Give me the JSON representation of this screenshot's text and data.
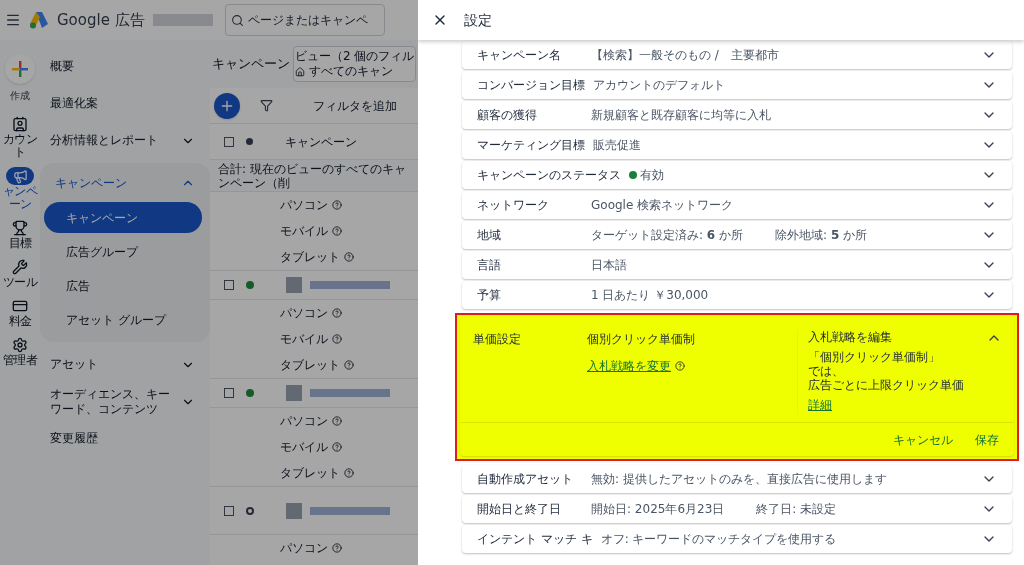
{
  "topbar": {
    "product": "Google 広告",
    "search": {
      "placeholder": "ページまたはキャンペ"
    }
  },
  "rail": [
    {
      "label": "作成",
      "kind": "create",
      "selected": false
    },
    {
      "label": "カウント",
      "kind": "account",
      "selected": false
    },
    {
      "label": "ャンペーン",
      "kind": "campaign",
      "selected": true
    },
    {
      "label": "目標",
      "kind": "goal",
      "selected": false
    },
    {
      "label": "ツール",
      "kind": "tools",
      "selected": false
    },
    {
      "label": "料金",
      "kind": "billing",
      "selected": false
    },
    {
      "label": "管理者",
      "kind": "admin",
      "selected": false
    }
  ],
  "nav": [
    {
      "label": "概要"
    },
    {
      "label": "最適化案"
    },
    {
      "label": "分析情報とレポート",
      "expanded": false
    },
    {
      "label": "キャンペーン",
      "expanded": true,
      "children": [
        {
          "label": "キャンペーン",
          "selected": true
        },
        {
          "label": "広告グループ",
          "selected": false
        },
        {
          "label": "広告",
          "selected": false
        },
        {
          "label": "アセット グループ",
          "selected": false
        }
      ]
    },
    {
      "label": "アセット",
      "expanded": false
    },
    {
      "label": "オーディエンス、キーワード、コンテンツ",
      "expanded": false
    },
    {
      "label": "変更履歴"
    }
  ],
  "main": {
    "title": "キャンペーン",
    "view_chip": {
      "line_1": "ビュー（2 個のフィル",
      "line_2": "すべてのキャン"
    },
    "filter_label": "フィルタを追加",
    "select_all_checked": false,
    "column_header": "キャンペーン",
    "total_row": "合計: 現在のビューのすべてのキャンペーン（削",
    "devices_top": [
      "パソコン",
      "モバイル",
      "タブレット"
    ],
    "campaigns": [
      {
        "checked": false,
        "kind": "enabled",
        "devices": [
          "パソコン",
          "モバイル",
          "タブレット"
        ]
      },
      {
        "checked": false,
        "kind": "enabled",
        "devices": [
          "パソコン",
          "モバイル",
          "タブレット"
        ]
      },
      {
        "checked": false,
        "kind": "paused",
        "devices": [
          "パソコン"
        ]
      }
    ]
  },
  "panel": {
    "title": "設定",
    "rows": [
      {
        "kind": "plain",
        "label": "キャンペーン名",
        "value": "【検索】一般そのもの /　主要都市"
      },
      {
        "kind": "plain",
        "label": "コンバージョン目標",
        "value": "アカウントのデフォルト"
      },
      {
        "kind": "plain",
        "label": "顧客の獲得",
        "value": "新規顧客と既存顧客に均等に入札"
      },
      {
        "kind": "plain",
        "label": "マーケティング目標",
        "value": "販売促進"
      },
      {
        "kind": "status",
        "label": "キャンペーンのステータス",
        "value": "有効",
        "color": "#188038"
      },
      {
        "kind": "plain",
        "label": "ネットワーク",
        "value": "Google 検索ネットワーク"
      },
      {
        "kind": "pair",
        "label": "地域",
        "value": "ターゲット設定済み: **6** か所",
        "value_2": "除外地域: **5** か所"
      },
      {
        "kind": "plain",
        "label": "言語",
        "value": "日本語"
      },
      {
        "kind": "plain",
        "label": "予算",
        "value": "1 日あたり ￥30,000"
      },
      {
        "kind": "expanded",
        "label": "単価設定",
        "highlighted": true,
        "value": "個別クリック単価制",
        "link": "入札戦略を変更",
        "side_title": "入札戦略を編集",
        "side_text_1": "「個別クリック単価制」",
        "side_text_2": "では、",
        "side_text_3": "広告ごとに上限クリック単価",
        "side_link": "詳細",
        "buttons": [
          "キャンセル",
          "保存"
        ]
      },
      {
        "kind": "plain",
        "label": "自動作成アセット",
        "value": "無効: 提供したアセットのみを、直接広告に使用します"
      },
      {
        "kind": "pair",
        "label": "開始日と終了日",
        "value": "開始日: 2025年6月23日",
        "value_2": "終了日: 未設定"
      },
      {
        "kind": "plain",
        "label": "インテント マッチ キ",
        "value": "オフ: キーワードのマッチタイプを使用する"
      }
    ]
  }
}
